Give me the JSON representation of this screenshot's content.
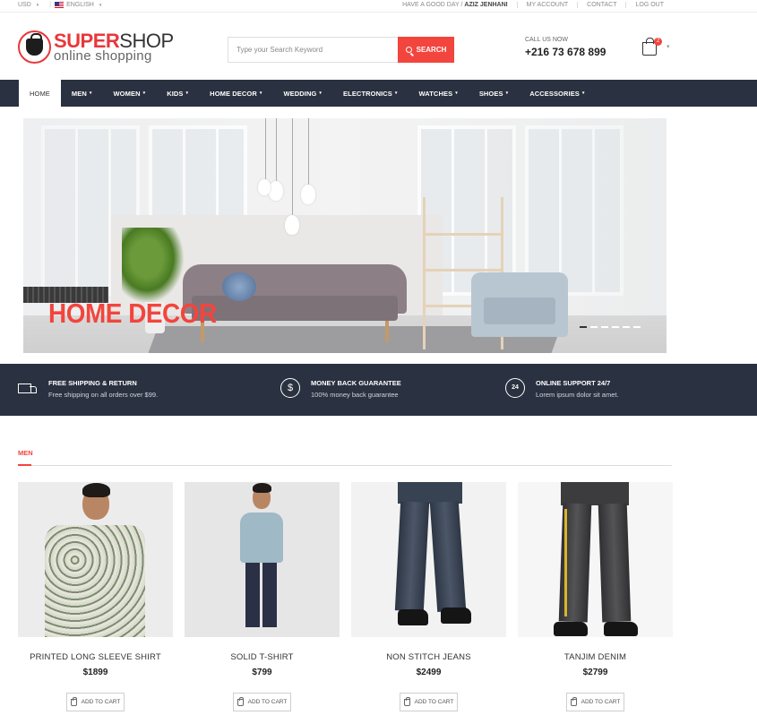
{
  "topbar": {
    "currency": "USD",
    "language": "ENGLISH",
    "greeting_prefix": "HAVE A GOOD DAY /",
    "user_name": "AZIZ JENHANI",
    "links": [
      "MY ACCOUNT",
      "CONTACT",
      "LOG OUT"
    ]
  },
  "header": {
    "logo_super": "SUPER",
    "logo_shop": "SHOP",
    "logo_sub": "online shopping",
    "search_placeholder": "Type your Search Keyword",
    "search_button": "SEARCH",
    "call_label": "CALL US NOW",
    "phone": "+216 73 678 899",
    "cart_count": "2"
  },
  "nav": [
    {
      "label": "HOME",
      "dropdown": false
    },
    {
      "label": "MEN",
      "dropdown": true
    },
    {
      "label": "WOMEN",
      "dropdown": true
    },
    {
      "label": "KIDS",
      "dropdown": true
    },
    {
      "label": "HOME DECOR",
      "dropdown": true
    },
    {
      "label": "WEDDING",
      "dropdown": true
    },
    {
      "label": "ELECTRONICS",
      "dropdown": true
    },
    {
      "label": "WATCHES",
      "dropdown": true
    },
    {
      "label": "SHOES",
      "dropdown": true
    },
    {
      "label": "ACCESSORIES",
      "dropdown": true
    }
  ],
  "banner": {
    "title": "HOME DECOR",
    "slide_count": 6,
    "active_slide": 0
  },
  "features": [
    {
      "icon": "truck-icon",
      "title": "FREE SHIPPING & RETURN",
      "desc": "Free shipping on all orders over $99."
    },
    {
      "icon": "dollar-icon",
      "title": "MONEY BACK GUARANTEE",
      "desc": "100% money back guarantee"
    },
    {
      "icon": "support-24-icon",
      "title": "ONLINE SUPPORT 24/7",
      "desc": "Lorem ipsum dolor sit amet."
    }
  ],
  "section": {
    "title": "MEN"
  },
  "products": [
    {
      "name": "PRINTED LONG SLEEVE SHIRT",
      "price": "$1899",
      "button": "ADD TO CART"
    },
    {
      "name": "SOLID T-SHIRT",
      "price": "$799",
      "button": "ADD TO CART"
    },
    {
      "name": "NON STITCH JEANS",
      "price": "$2499",
      "button": "ADD TO CART"
    },
    {
      "name": "TANJIM DENIM",
      "price": "$2799",
      "button": "ADD TO CART"
    }
  ],
  "glyphs": {
    "caret": "▾",
    "dollar": "$",
    "support": "24"
  },
  "colors": {
    "accent": "#f2453d",
    "navy": "#2a3140"
  }
}
